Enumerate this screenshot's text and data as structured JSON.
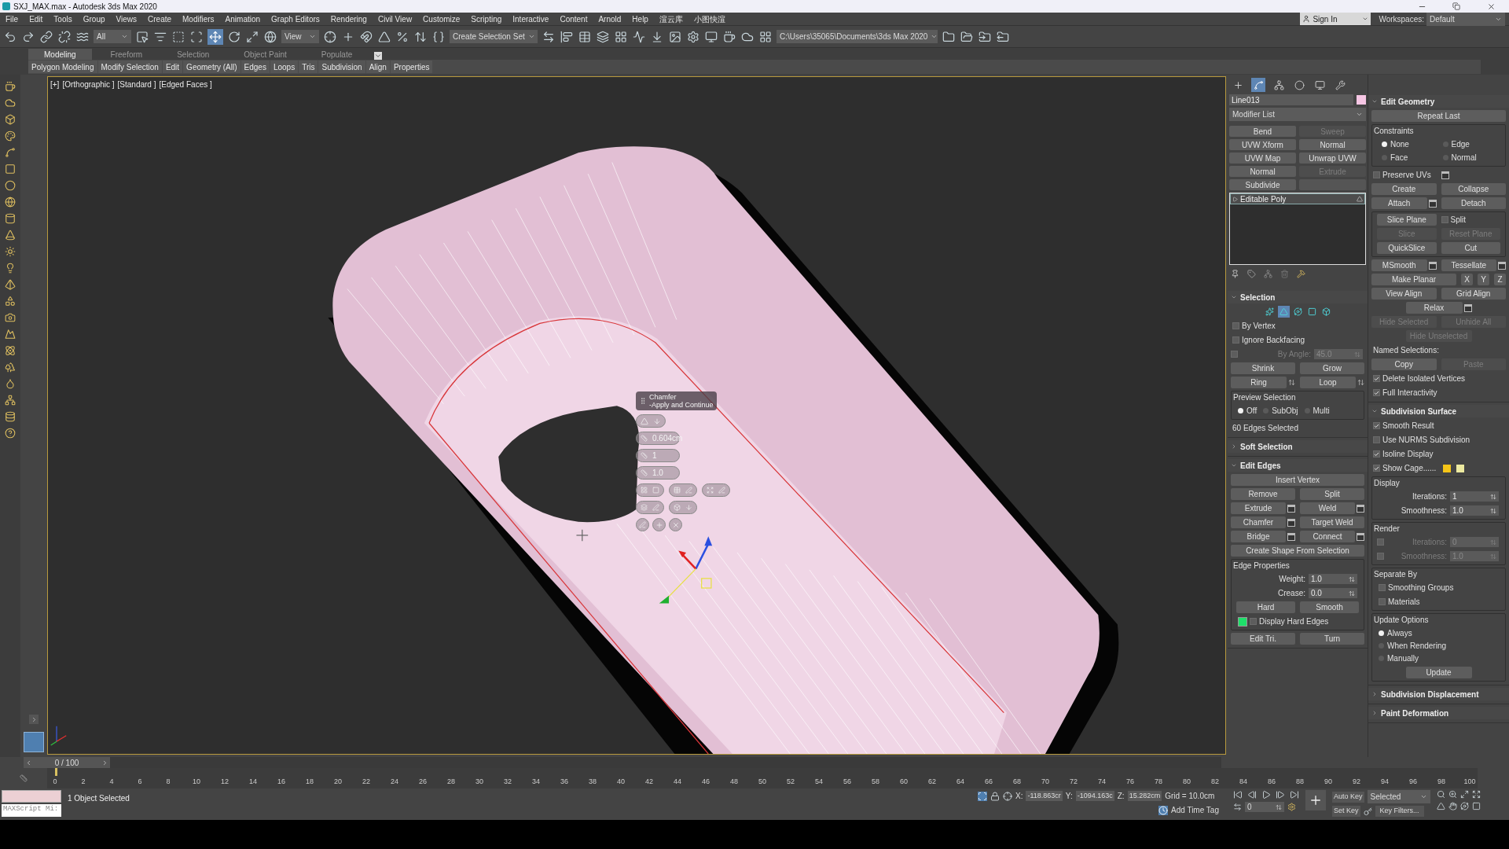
{
  "window": {
    "title": "SXJ_MAX.max - Autodesk 3ds Max 2020"
  },
  "menu": [
    "File",
    "Edit",
    "Tools",
    "Group",
    "Views",
    "Create",
    "Modifiers",
    "Animation",
    "Graph Editors",
    "Rendering",
    "Civil View",
    "Customize",
    "Scripting",
    "Interactive",
    "Content",
    "Arnold",
    "Help",
    "渲云库",
    "小图快渲"
  ],
  "account": {
    "sign_in": "Sign In",
    "workspaces_label": "Workspaces:",
    "workspace": "Default"
  },
  "toolbar": {
    "selection_filter": "All",
    "reference_coord": "View",
    "named_selection": "Create Selection Set",
    "project_path": "C:\\Users\\35065\\Documents\\3ds Max 2020"
  },
  "ribbon": {
    "tabs": [
      {
        "label": "Modeling",
        "selected": true
      },
      {
        "label": "Freeform",
        "selected": false
      },
      {
        "label": "Selection",
        "selected": false
      },
      {
        "label": "Object Paint",
        "selected": false
      },
      {
        "label": "Populate",
        "selected": false
      }
    ],
    "panels": [
      "Polygon Modeling",
      "Modify Selection",
      "Edit",
      "Geometry (All)",
      "Edges",
      "Loops",
      "Tris",
      "Subdivision",
      "Align",
      "Properties"
    ]
  },
  "viewport": {
    "labels": [
      "[+]",
      "[Orthographic ]",
      "[Standard ]",
      "[Edged Faces ]"
    ],
    "caddy": {
      "title": "Chamfer",
      "subtitle": "-Apply and Continue",
      "values": [
        "0.604cm",
        "1",
        "1.0"
      ]
    }
  },
  "command_panel": {
    "tabs": [
      {
        "kind": "create",
        "selected": false
      },
      {
        "kind": "modify",
        "selected": true
      },
      {
        "kind": "hierarchy",
        "selected": false
      },
      {
        "kind": "motion",
        "selected": false
      },
      {
        "kind": "display",
        "selected": false
      },
      {
        "kind": "utilities",
        "selected": false
      }
    ],
    "object_name": "Line013",
    "modifier_list": "Modifier List",
    "modifier_buttons": [
      {
        "label": "Bend"
      },
      {
        "label": "Sweep",
        "disabled": true
      },
      {
        "label": "UVW Xform"
      },
      {
        "label": "Normal"
      },
      {
        "label": "UVW Map"
      },
      {
        "label": "Unwrap UVW"
      },
      {
        "label": "Normal"
      },
      {
        "label": "Extrude",
        "disabled": true
      },
      {
        "label": "Subdivide"
      }
    ],
    "stack": [
      {
        "label": "Editable Poly",
        "selected": true
      }
    ],
    "rollouts_left": [
      {
        "title": "Selection",
        "expanded": true,
        "items": [
          {
            "kind": "subobjects",
            "levels": [
              {
                "kind": "vertex",
                "selected": false
              },
              {
                "kind": "edge",
                "selected": true
              },
              {
                "kind": "border",
                "selected": false
              },
              {
                "kind": "polygon",
                "selected": false
              },
              {
                "kind": "element",
                "selected": false
              }
            ]
          },
          {
            "kind": "check",
            "label": "By Vertex",
            "checked": false
          },
          {
            "kind": "check",
            "label": "Ignore Backfacing",
            "checked": false
          },
          {
            "kind": "spinner_check",
            "label": "By Angle:",
            "value": "45.0",
            "checked": false,
            "disabled": true
          },
          {
            "kind": "buttons",
            "buttons": [
              {
                "label": "Shrink"
              },
              {
                "label": "Grow"
              }
            ]
          },
          {
            "kind": "buttons",
            "buttons": [
              {
                "label": "Ring",
                "arrows": true
              },
              {
                "label": "Loop",
                "arrows": true
              }
            ]
          },
          {
            "kind": "group",
            "title": "Preview Selection",
            "items": [
              {
                "kind": "radios_row",
                "options": [
                  {
                    "label": "Off",
                    "selected": true
                  },
                  {
                    "label": "SubObj",
                    "selected": false
                  },
                  {
                    "label": "Multi",
                    "selected": false
                  }
                ]
              }
            ]
          },
          {
            "kind": "text",
            "text": "60 Edges Selected"
          }
        ]
      },
      {
        "title": "Soft Selection",
        "expanded": false
      },
      {
        "title": "Edit Edges",
        "expanded": true,
        "items": [
          {
            "kind": "buttons",
            "buttons": [
              {
                "label": "Insert Vertex"
              }
            ]
          },
          {
            "kind": "buttons",
            "buttons": [
              {
                "label": "Remove"
              },
              {
                "label": "Split"
              }
            ]
          },
          {
            "kind": "buttons",
            "buttons": [
              {
                "label": "Extrude",
                "settings": true
              },
              {
                "label": "Weld",
                "settings": true
              }
            ]
          },
          {
            "kind": "buttons",
            "buttons": [
              {
                "label": "Chamfer",
                "settings": true
              },
              {
                "label": "Target Weld"
              }
            ]
          },
          {
            "kind": "buttons",
            "buttons": [
              {
                "label": "Bridge",
                "settings": true
              },
              {
                "label": "Connect",
                "settings": true
              }
            ]
          },
          {
            "kind": "buttons",
            "buttons": [
              {
                "label": "Create Shape From Selection"
              }
            ]
          },
          {
            "kind": "group",
            "title": "Edge Properties",
            "items": [
              {
                "kind": "spinner",
                "label": "Weight:",
                "value": "1.0"
              },
              {
                "kind": "spinner",
                "label": "Crease:",
                "value": "0.0"
              },
              {
                "kind": "buttons",
                "buttons": [
                  {
                    "label": "Hard"
                  },
                  {
                    "label": "Smooth"
                  }
                ]
              },
              {
                "kind": "swatch_check",
                "label": "Display Hard Edges",
                "checked": false
              }
            ]
          },
          {
            "kind": "buttons",
            "buttons": [
              {
                "label": "Edit Tri."
              },
              {
                "label": "Turn"
              }
            ]
          }
        ]
      }
    ],
    "rollouts_right": [
      {
        "title": "Edit Geometry",
        "expanded": true,
        "items": [
          {
            "kind": "buttons",
            "buttons": [
              {
                "label": "Repeat Last"
              }
            ]
          },
          {
            "kind": "group",
            "title": "Constraints",
            "items": [
              {
                "kind": "radios_grid",
                "options": [
                  {
                    "label": "None",
                    "selected": true
                  },
                  {
                    "label": "Edge",
                    "selected": false
                  },
                  {
                    "label": "Face",
                    "selected": false
                  },
                  {
                    "label": "Normal",
                    "selected": false
                  }
                ]
              }
            ]
          },
          {
            "kind": "check",
            "label": "Preserve UVs",
            "checked": false,
            "settings": true
          },
          {
            "kind": "buttons",
            "buttons": [
              {
                "label": "Create"
              },
              {
                "label": "Collapse"
              }
            ]
          },
          {
            "kind": "buttons",
            "buttons": [
              {
                "label": "Attach",
                "settings": true
              },
              {
                "label": "Detach"
              }
            ]
          },
          {
            "kind": "group",
            "items": [
              {
                "kind": "button_check",
                "button": "Slice Plane",
                "label": "Split",
                "checked": false
              },
              {
                "kind": "buttons",
                "buttons": [
                  {
                    "label": "Slice",
                    "disabled": true
                  },
                  {
                    "label": "Reset Plane",
                    "disabled": true
                  }
                ]
              },
              {
                "kind": "buttons",
                "buttons": [
                  {
                    "label": "QuickSlice"
                  },
                  {
                    "label": "Cut"
                  }
                ]
              }
            ]
          },
          {
            "kind": "buttons",
            "buttons": [
              {
                "label": "MSmooth",
                "settings": true
              },
              {
                "label": "Tessellate",
                "settings": true
              }
            ]
          },
          {
            "kind": "buttons",
            "buttons": [
              {
                "label": "Make Planar"
              },
              {
                "label": "X"
              },
              {
                "label": "Y"
              },
              {
                "label": "Z"
              }
            ]
          },
          {
            "kind": "buttons",
            "buttons": [
              {
                "label": "View Align"
              },
              {
                "label": "Grid Align"
              }
            ]
          },
          {
            "kind": "buttons",
            "centered": true,
            "buttons": [
              {
                "label": "Relax",
                "settings": true
              }
            ]
          },
          {
            "kind": "buttons",
            "buttons": [
              {
                "label": "Hide Selected",
                "disabled": true
              },
              {
                "label": "Unhide All",
                "disabled": true
              }
            ]
          },
          {
            "kind": "buttons",
            "centered": true,
            "buttons": [
              {
                "label": "Hide Unselected",
                "disabled": true
              }
            ]
          },
          {
            "kind": "text",
            "text": "Named Selections:"
          },
          {
            "kind": "buttons",
            "buttons": [
              {
                "label": "Copy"
              },
              {
                "label": "Paste",
                "disabled": true
              }
            ]
          },
          {
            "kind": "check",
            "label": "Delete Isolated Vertices",
            "checked": true
          },
          {
            "kind": "check",
            "label": "Full Interactivity",
            "checked": true
          }
        ]
      },
      {
        "title": "Subdivision Surface",
        "expanded": true,
        "items": [
          {
            "kind": "check",
            "label": "Smooth Result",
            "checked": true
          },
          {
            "kind": "check",
            "label": "Use NURMS Subdivision",
            "checked": false
          },
          {
            "kind": "check",
            "label": "Isoline Display",
            "checked": true
          },
          {
            "kind": "check_swatch",
            "label": "Show Cage......",
            "checked": true
          },
          {
            "kind": "group",
            "title": "Display",
            "items": [
              {
                "kind": "spinner",
                "label": "Iterations:",
                "value": "1"
              },
              {
                "kind": "spinner",
                "label": "Smoothness:",
                "value": "1.0"
              }
            ]
          },
          {
            "kind": "group",
            "title": "Render",
            "items": [
              {
                "kind": "spinner_check",
                "label": "Iterations:",
                "value": "0",
                "checked": false,
                "disabled": true
              },
              {
                "kind": "spinner_check",
                "label": "Smoothness:",
                "value": "1.0",
                "checked": false,
                "disabled": true
              }
            ]
          },
          {
            "kind": "group",
            "title": "Separate By",
            "items": [
              {
                "kind": "check",
                "label": "Smoothing Groups",
                "checked": false
              },
              {
                "kind": "check",
                "label": "Materials",
                "checked": false
              }
            ]
          },
          {
            "kind": "group",
            "title": "Update Options",
            "items": [
              {
                "kind": "radios_column",
                "options": [
                  {
                    "label": "Always",
                    "selected": true
                  },
                  {
                    "label": "When Rendering",
                    "selected": false
                  },
                  {
                    "label": "Manually",
                    "selected": false
                  }
                ]
              },
              {
                "kind": "buttons",
                "centered": true,
                "buttons": [
                  {
                    "label": "Update"
                  }
                ]
              }
            ]
          }
        ]
      },
      {
        "title": "Subdivision Displacement",
        "expanded": false
      },
      {
        "title": "Paint Deformation",
        "expanded": false
      }
    ]
  },
  "timeline": {
    "position": "0 / 100",
    "level": 0,
    "ticks": [
      "0",
      "2",
      "4",
      "6",
      "8",
      "10",
      "12",
      "14",
      "16",
      "18",
      "20",
      "22",
      "24",
      "26",
      "28",
      "30",
      "32",
      "34",
      "36",
      "38",
      "40",
      "42",
      "44",
      "46",
      "48",
      "50",
      "52",
      "54",
      "56",
      "58",
      "60",
      "62",
      "64",
      "66",
      "68",
      "70",
      "72",
      "74",
      "76",
      "78",
      "80",
      "82",
      "84",
      "86",
      "88",
      "90",
      "92",
      "94",
      "96",
      "98",
      "100"
    ]
  },
  "status": {
    "listener": "MAXScript Mi:",
    "message": "1 Object Selected",
    "coords": [
      {
        "label": "X:",
        "value": "-118.863cr"
      },
      {
        "label": "Y:",
        "value": "-1094.163c"
      },
      {
        "label": "Z:",
        "value": "15.282cm"
      }
    ],
    "grid": "Grid = 10.0cm",
    "add_time_tag": "Add Time Tag",
    "auto_key": "Auto Key",
    "key_mode": "Selected",
    "set_key": "Set Key",
    "key_filters": "Key Filters...",
    "frame": "0"
  }
}
